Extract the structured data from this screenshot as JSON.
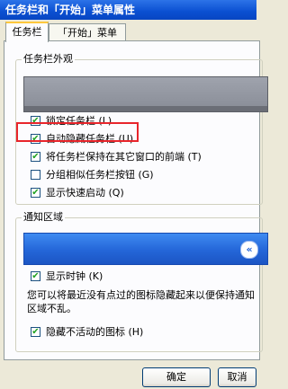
{
  "window": {
    "title": "任务栏和「开始」菜单属性"
  },
  "tabs": [
    {
      "label": "任务栏"
    },
    {
      "label": "「开始」菜单"
    }
  ],
  "appearance": {
    "legend": "任务栏外观",
    "options": [
      {
        "label": "锁定任务栏 (L)",
        "checked": true
      },
      {
        "label": "自动隐藏任务栏 (U)",
        "checked": true
      },
      {
        "label": "将任务栏保持在其它窗口的前端 (T)",
        "checked": true
      },
      {
        "label": "分组相似任务栏按钮 (G)",
        "checked": false
      },
      {
        "label": "显示快速启动 (Q)",
        "checked": true
      }
    ]
  },
  "notification": {
    "legend": "通知区域",
    "tray_button": "«",
    "show_clock": {
      "label": "显示时钟 (K)",
      "checked": true
    },
    "description": "您可以将最近没有点过的图标隐藏起来以便保持通知区域不乱。",
    "hide_inactive": {
      "label": "隐藏不活动的图标 (H)",
      "checked": true
    }
  },
  "buttons": {
    "ok": "确定",
    "cancel": "取消"
  },
  "colors": {
    "highlight": "#E8252B",
    "titlebar": "#0A4FD1"
  }
}
